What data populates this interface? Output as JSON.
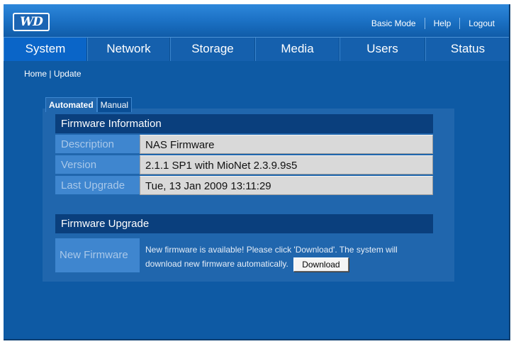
{
  "header": {
    "logo_text": "WD",
    "links": [
      "Basic Mode",
      "Help",
      "Logout"
    ]
  },
  "nav": {
    "tabs": [
      "System",
      "Network",
      "Storage",
      "Media",
      "Users",
      "Status"
    ],
    "active": "System"
  },
  "breadcrumb": {
    "home": "Home",
    "separator": "|",
    "current": "Update"
  },
  "subtabs": {
    "automated": "Automated",
    "manual": "Manual",
    "active": "Automated"
  },
  "firmware_info": {
    "title": "Firmware Information",
    "rows": [
      {
        "label": "Description",
        "value": "NAS Firmware"
      },
      {
        "label": "Version",
        "value": "2.1.1 SP1 with MioNet 2.3.9.9s5"
      },
      {
        "label": "Last Upgrade",
        "value": "Tue, 13 Jan 2009 13:11:29"
      }
    ]
  },
  "firmware_upgrade": {
    "title": "Firmware Upgrade",
    "label": "New Firmware",
    "message": "New firmware is available! Please click 'Download'. The system will download new firmware automatically.",
    "download_label": "Download"
  },
  "colors": {
    "background": "#0e5aa4",
    "section_header": "#0a3f7d",
    "label_cell": "#3f86cf",
    "value_cell": "#d9d9d9"
  }
}
